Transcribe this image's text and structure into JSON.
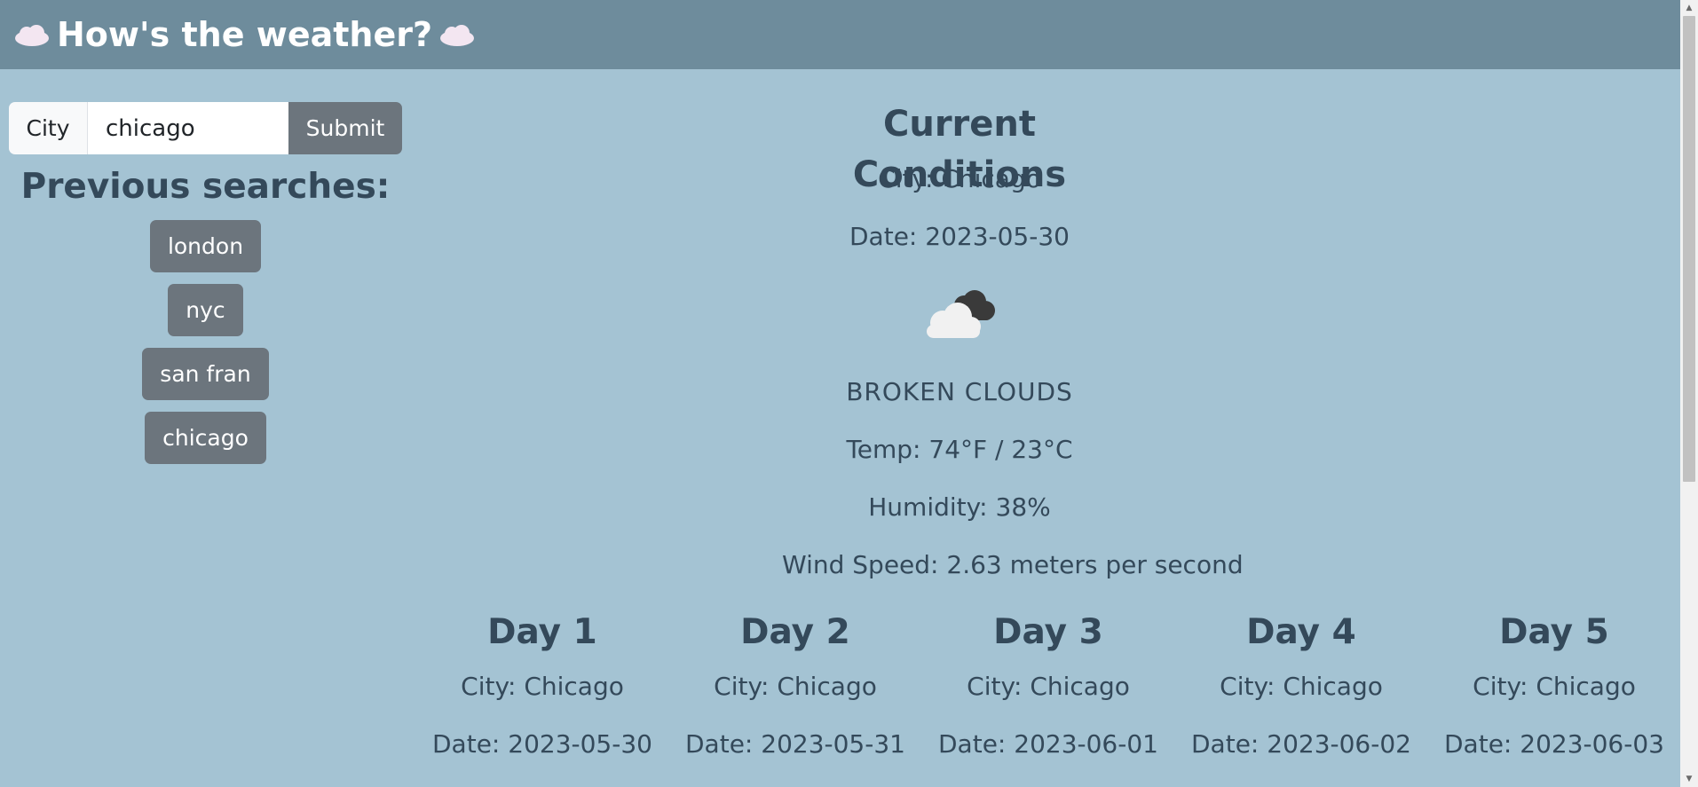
{
  "header": {
    "title": "How's the weather?",
    "leading_icon": "cloud-emoji",
    "trailing_icon": "cloud-emoji"
  },
  "search": {
    "label": "City",
    "value": "chicago",
    "submit_label": "Submit"
  },
  "history": {
    "heading": "Previous searches:",
    "items": [
      "london",
      "nyc",
      "san fran",
      "chicago"
    ]
  },
  "current": {
    "heading": "Current Conditions",
    "city": "City: Chicago",
    "date": "Date: 2023-05-30",
    "icon": "broken-clouds-icon",
    "description": "BROKEN CLOUDS",
    "temp": "Temp: 74°F / 23°C",
    "humidity": "Humidity: 38%",
    "wind": "Wind Speed: 2.63 meters per second"
  },
  "forecast": [
    {
      "title": "Day 1",
      "city": "City: Chicago",
      "date": "Date: 2023-05-30"
    },
    {
      "title": "Day 2",
      "city": "City: Chicago",
      "date": "Date: 2023-05-31"
    },
    {
      "title": "Day 3",
      "city": "City: Chicago",
      "date": "Date: 2023-06-01"
    },
    {
      "title": "Day 4",
      "city": "City: Chicago",
      "date": "Date: 2023-06-02"
    },
    {
      "title": "Day 5",
      "city": "City: Chicago",
      "date": "Date: 2023-06-03"
    }
  ],
  "colors": {
    "page_bg": "#a4c3d3",
    "header_bg": "#6e8c9c",
    "button_bg": "#6c757d",
    "text": "#34495a"
  }
}
